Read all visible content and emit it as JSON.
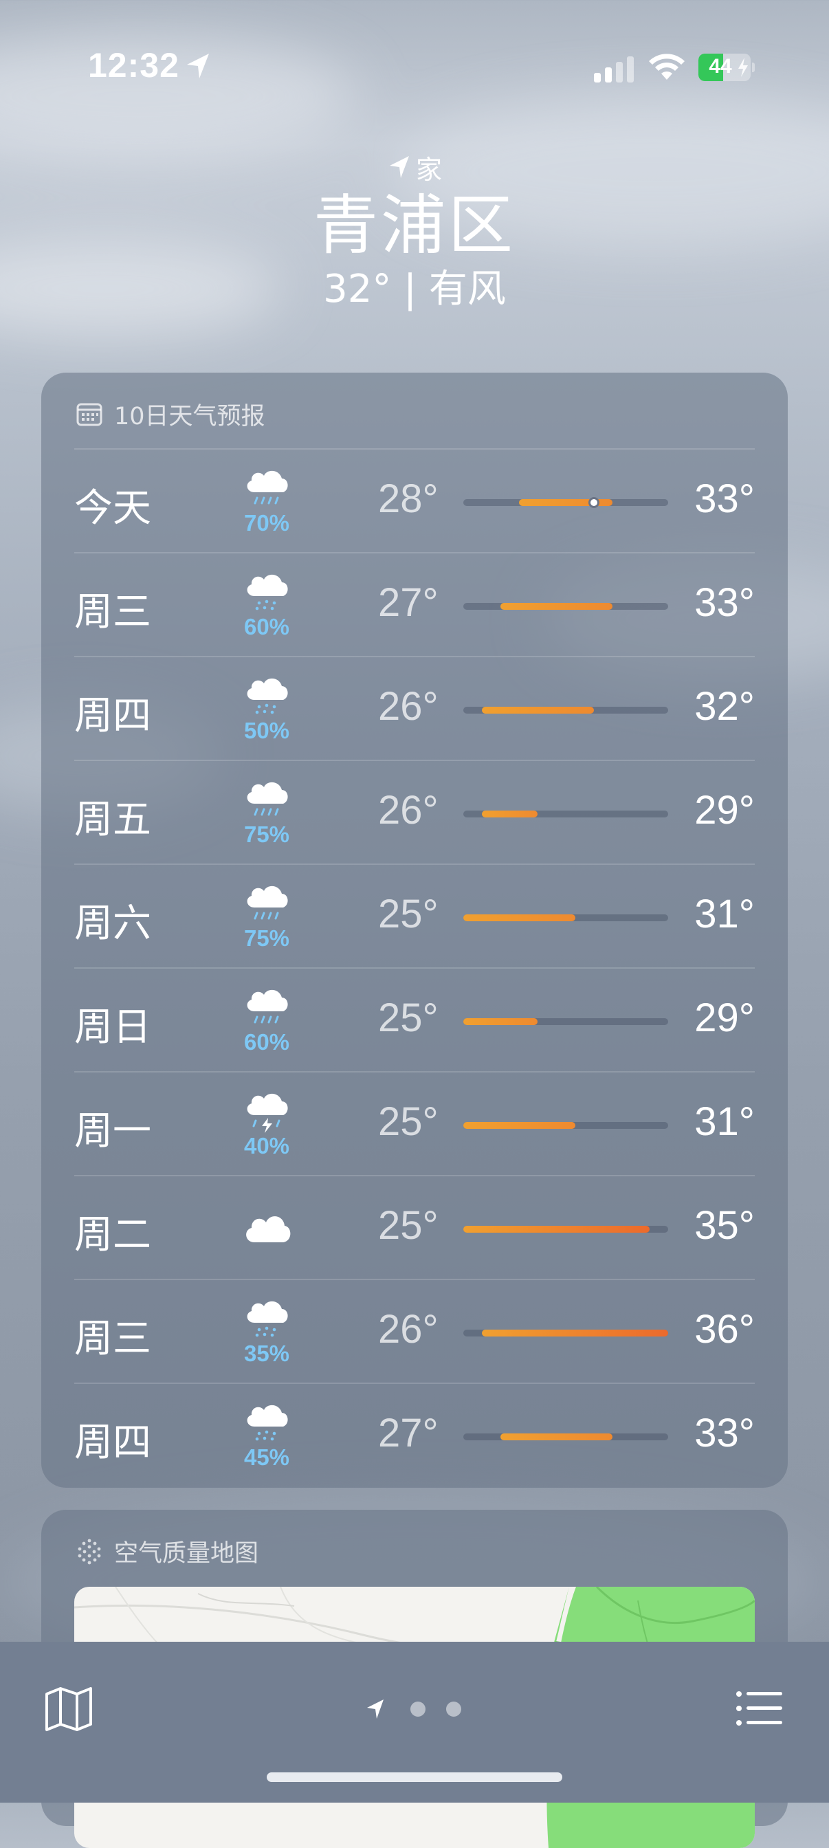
{
  "status_bar": {
    "time": "12:32",
    "battery_level": "44"
  },
  "header": {
    "home_label": "家",
    "city": "青浦区",
    "current_summary": "32° | 有风"
  },
  "forecast": {
    "title": "10日天气预报",
    "scale_min": 25,
    "scale_max": 36,
    "now_temp": 32,
    "days": [
      {
        "day": "今天",
        "icon": "rain-icon",
        "precip": "70%",
        "low": "28°",
        "high": "33°",
        "low_val": 28,
        "high_val": 33
      },
      {
        "day": "周三",
        "icon": "drizzle-icon",
        "precip": "60%",
        "low": "27°",
        "high": "33°",
        "low_val": 27,
        "high_val": 33
      },
      {
        "day": "周四",
        "icon": "drizzle-icon",
        "precip": "50%",
        "low": "26°",
        "high": "32°",
        "low_val": 26,
        "high_val": 32
      },
      {
        "day": "周五",
        "icon": "rain-icon",
        "precip": "75%",
        "low": "26°",
        "high": "29°",
        "low_val": 26,
        "high_val": 29
      },
      {
        "day": "周六",
        "icon": "rain-icon",
        "precip": "75%",
        "low": "25°",
        "high": "31°",
        "low_val": 25,
        "high_val": 31
      },
      {
        "day": "周日",
        "icon": "rain-icon",
        "precip": "60%",
        "low": "25°",
        "high": "29°",
        "low_val": 25,
        "high_val": 29
      },
      {
        "day": "周一",
        "icon": "thunderstorm-icon",
        "precip": "40%",
        "low": "25°",
        "high": "31°",
        "low_val": 25,
        "high_val": 31
      },
      {
        "day": "周二",
        "icon": "cloud-icon",
        "precip": "",
        "low": "25°",
        "high": "35°",
        "low_val": 25,
        "high_val": 35
      },
      {
        "day": "周三",
        "icon": "drizzle-icon",
        "precip": "35%",
        "low": "26°",
        "high": "36°",
        "low_val": 26,
        "high_val": 36
      },
      {
        "day": "周四",
        "icon": "drizzle-icon",
        "precip": "45%",
        "low": "27°",
        "high": "33°",
        "low_val": 27,
        "high_val": 33
      }
    ]
  },
  "air_quality": {
    "title": "空气质量地图"
  },
  "colors": {
    "precip": "#7ec8f5",
    "bar_warm": "#f0a030",
    "bar_hot": "#ec6a2c",
    "aqi_good": "#86dd7a"
  },
  "toolbar": {
    "map_icon": "map-icon",
    "location_icon": "location-arrow-icon",
    "list_icon": "list-icon"
  }
}
